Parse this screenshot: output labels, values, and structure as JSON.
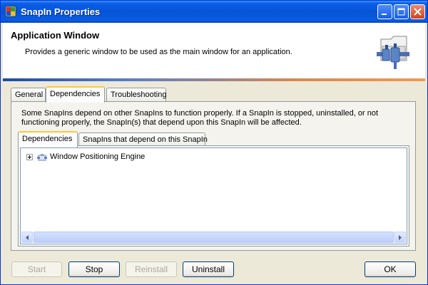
{
  "window": {
    "title": "SnapIn Properties"
  },
  "header": {
    "title": "Application Window",
    "description": "Provides a generic window to be used as the main window for an application."
  },
  "tabs": [
    {
      "label": "General",
      "selected": false
    },
    {
      "label": "Dependencies",
      "selected": true
    },
    {
      "label": "Troubleshooting",
      "selected": false
    }
  ],
  "dependencies": {
    "description": "Some SnapIns depend on other SnapIns to function properly. If a SnapIn is stopped, uninstalled, or not functioning properly, the SnapIn(s) that depend upon this SnapIn will be affected.",
    "inner_tabs": [
      {
        "label": "Dependencies",
        "selected": true
      },
      {
        "label": "SnapIns that depend on this SnapIn",
        "selected": false
      }
    ],
    "tree_items": [
      {
        "label": "Window Positioning Engine",
        "icon": "snapin-icon",
        "expandable": true
      }
    ]
  },
  "buttons": {
    "start": {
      "label": "Start",
      "enabled": false
    },
    "stop": {
      "label": "Stop",
      "enabled": true
    },
    "reinstall": {
      "label": "Reinstall",
      "enabled": false
    },
    "uninstall": {
      "label": "Uninstall",
      "enabled": true
    },
    "ok": {
      "label": "OK",
      "enabled": true
    }
  }
}
